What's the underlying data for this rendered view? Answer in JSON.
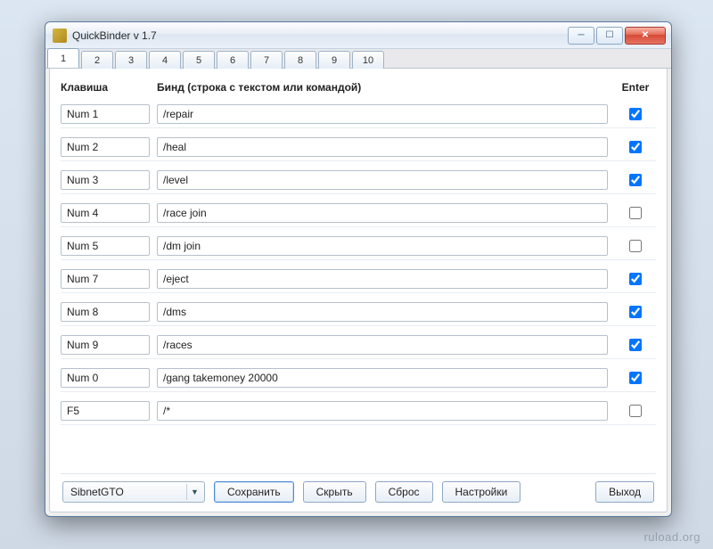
{
  "window": {
    "title": "QuickBinder v 1.7"
  },
  "tabs": [
    "1",
    "2",
    "3",
    "4",
    "5",
    "6",
    "7",
    "8",
    "9",
    "10"
  ],
  "active_tab_index": 0,
  "headers": {
    "key": "Клавиша",
    "bind": "Бинд (строка с текстом или командой)",
    "enter": "Enter"
  },
  "rows": [
    {
      "key": "Num 1",
      "bind": "/repair",
      "enter": true
    },
    {
      "key": "Num 2",
      "bind": "/heal",
      "enter": true
    },
    {
      "key": "Num 3",
      "bind": "/level",
      "enter": true
    },
    {
      "key": "Num 4",
      "bind": "/race join",
      "enter": false
    },
    {
      "key": "Num 5",
      "bind": "/dm join",
      "enter": false
    },
    {
      "key": "Num 7",
      "bind": "/eject",
      "enter": true
    },
    {
      "key": "Num 8",
      "bind": "/dms",
      "enter": true
    },
    {
      "key": "Num 9",
      "bind": "/races",
      "enter": true
    },
    {
      "key": "Num 0",
      "bind": "/gang takemoney 20000",
      "enter": true
    },
    {
      "key": "F5",
      "bind": "/*",
      "enter": false
    }
  ],
  "footer": {
    "profile_selected": "SibnetGTO",
    "save": "Сохранить",
    "hide": "Скрыть",
    "reset": "Сброс",
    "settings": "Настройки",
    "exit": "Выход"
  },
  "watermark": "ruload.org"
}
